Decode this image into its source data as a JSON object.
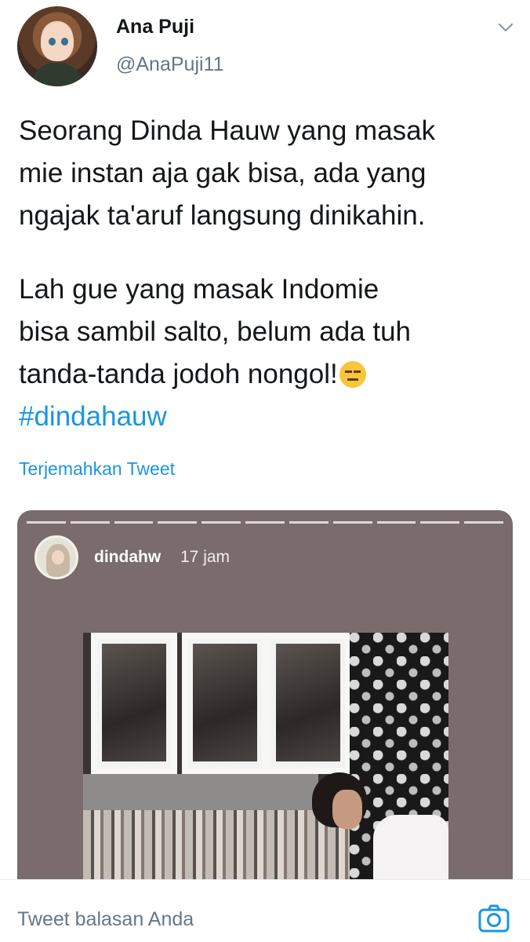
{
  "tweet": {
    "author_name": "Ana Puji",
    "author_handle": "@AnaPuji11",
    "text_lines_1": [
      "Seorang Dinda Hauw yang masak",
      "mie instan aja gak bisa, ada yang",
      "ngajak ta'aruf langsung dinikahin."
    ],
    "text_lines_2": [
      "Lah gue yang masak Indomie",
      "bisa sambil salto, belum ada tuh",
      "tanda-tanda jodoh nongol!"
    ],
    "emoji": "expressionless-face-emoji",
    "hashtag": "#dindahauw",
    "translate_label": "Terjemahkan Tweet"
  },
  "story": {
    "username": "dindahw",
    "time": "17 jam",
    "progress_segments": 11
  },
  "reply_bar": {
    "placeholder": "Tweet balasan Anda",
    "camera_icon": "camera-icon"
  },
  "colors": {
    "link": "#1b95e0",
    "secondary_text": "#657786",
    "primary_text": "#14171a"
  }
}
